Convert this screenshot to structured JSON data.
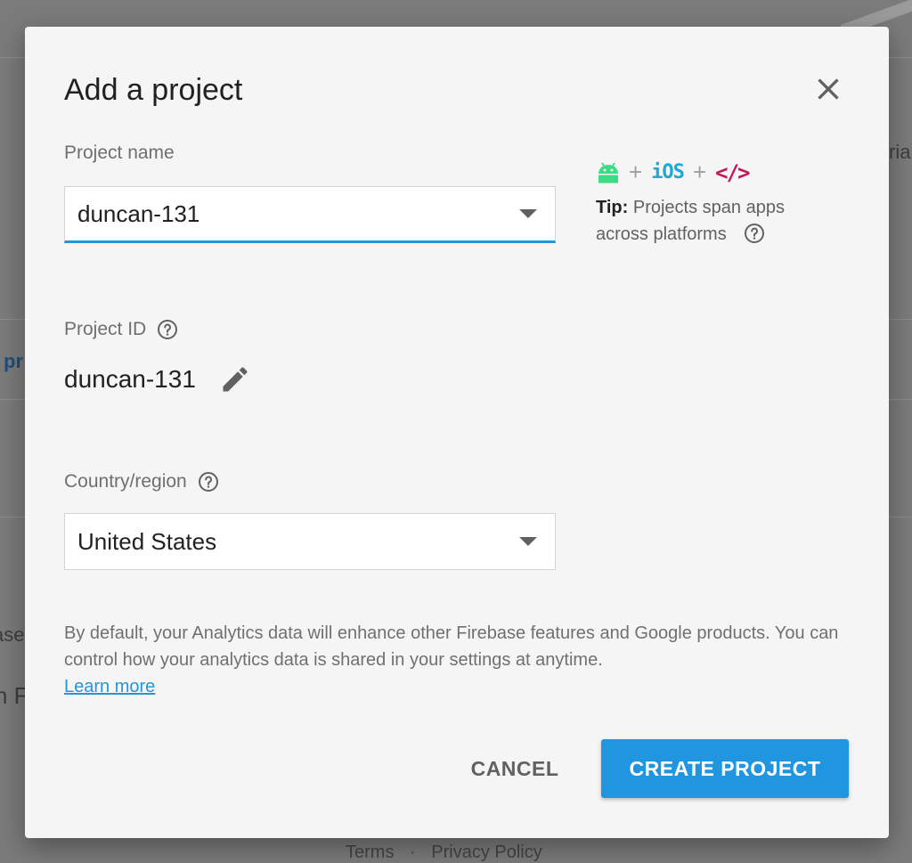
{
  "background": {
    "fragment_top_right": "ria",
    "fragment_link": "pr",
    "fragment_left_1": "ase",
    "fragment_left_2": "n F",
    "footer_terms": "Terms",
    "footer_separator": "·",
    "footer_privacy": "Privacy Policy"
  },
  "dialog": {
    "title": "Add a project",
    "project_name": {
      "label": "Project name",
      "value": "duncan-131"
    },
    "platforms": {
      "plus": "+",
      "ios": "iOS",
      "web": "</>",
      "tip_bold": "Tip:",
      "tip_text": "Projects span apps across platforms"
    },
    "project_id": {
      "label": "Project ID",
      "value": "duncan-131"
    },
    "country": {
      "label": "Country/region",
      "value": "United States"
    },
    "disclaimer": "By default, your Analytics data will enhance other Firebase features and Google products. You can control how your analytics data is shared in your settings at anytime.",
    "learn_more": "Learn more",
    "cancel_label": "CANCEL",
    "create_label": "CREATE PROJECT"
  },
  "colors": {
    "accent": "#2196e0",
    "android": "#3ddc84",
    "ios": "#1fa7d6",
    "web": "#c2185b"
  },
  "icons": [
    "close-icon",
    "help-icon",
    "edit-icon",
    "android-icon",
    "chevron-down-icon"
  ]
}
